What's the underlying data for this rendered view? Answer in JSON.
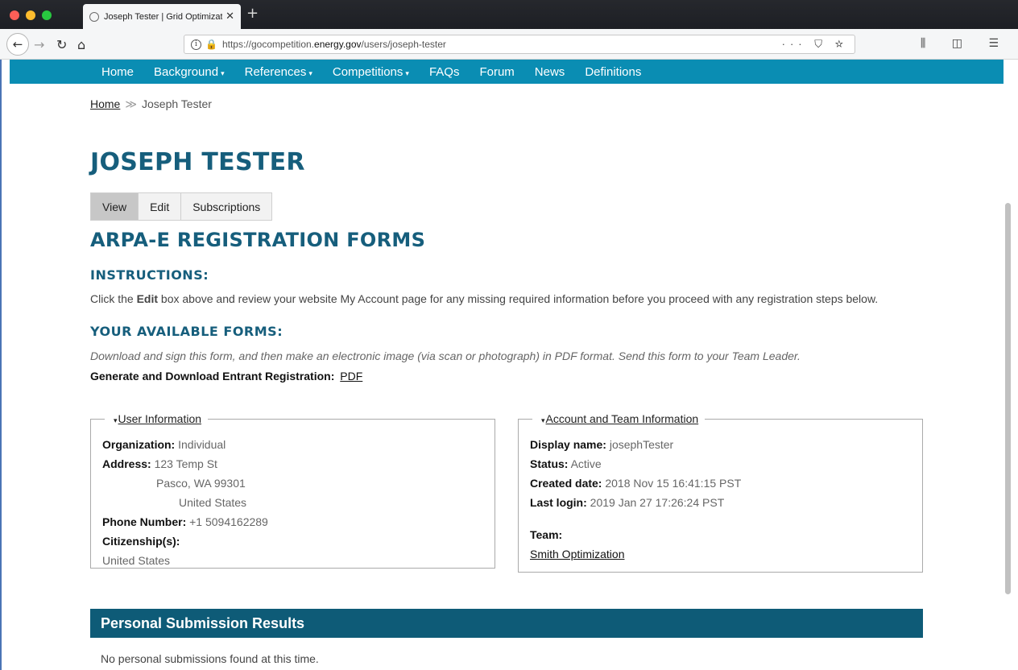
{
  "browser": {
    "tab_title": "Joseph Tester | Grid Optimizati",
    "new_tab": "+",
    "url_prefix": "https://gocompetition.",
    "url_domain": "energy.gov",
    "url_path": "/users/joseph-tester",
    "url_actions": "··· ⛉ ☆",
    "right_tools": "⫼ ◫ ☰"
  },
  "site_nav": {
    "items": [
      "Home",
      "Background",
      "References",
      "Competitions",
      "FAQs",
      "Forum",
      "News",
      "Definitions"
    ]
  },
  "breadcrumb": {
    "home": "Home",
    "separator": "≫",
    "current": "Joseph Tester"
  },
  "page_title": "JOSEPH TESTER",
  "tabs": [
    "View",
    "Edit",
    "Subscriptions"
  ],
  "section_title": "ARPA-E REGISTRATION FORMS",
  "instructions": {
    "heading": "INSTRUCTIONS:",
    "text_before": "Click the ",
    "text_bold": "Edit",
    "text_after": " box above and review your website My Account page for any missing required information before you proceed with any registration steps below."
  },
  "forms": {
    "heading": "YOUR AVAILABLE FORMS:",
    "note": "Download and sign this form, and then make an electronic image (via scan or photograph) in PDF format. Send this form to your Team Leader.",
    "generate_label": "Generate and Download Entrant Registration:",
    "pdf_link": "PDF"
  },
  "user_info": {
    "legend": "User Information",
    "organization_label": "Organization:",
    "organization": "Individual",
    "address_label": "Address:",
    "address_line1": "123 Temp St",
    "address_line2": "Pasco, WA 99301",
    "address_line3": "United States",
    "phone_label": "Phone Number:",
    "phone": "+1 5094162289",
    "citizenship_label": "Citizenship(s):",
    "citizenship": "United States"
  },
  "account_info": {
    "legend": "Account and Team Information",
    "display_name_label": "Display name:",
    "display_name": "josephTester",
    "status_label": "Status:",
    "status": "Active",
    "created_label": "Created date:",
    "created": "2018 Nov 15 16:41:15 PST",
    "last_login_label": "Last login:",
    "last_login": "2019 Jan 27 17:26:24 PST",
    "team_label": "Team:",
    "team": "Smith Optimization"
  },
  "results": {
    "heading": "Personal Submission Results",
    "empty": "No personal submissions found at this time."
  },
  "colors": {
    "nav_bg": "#0a8db3",
    "heading": "#165e7c",
    "results_bar": "#0e5b77"
  }
}
